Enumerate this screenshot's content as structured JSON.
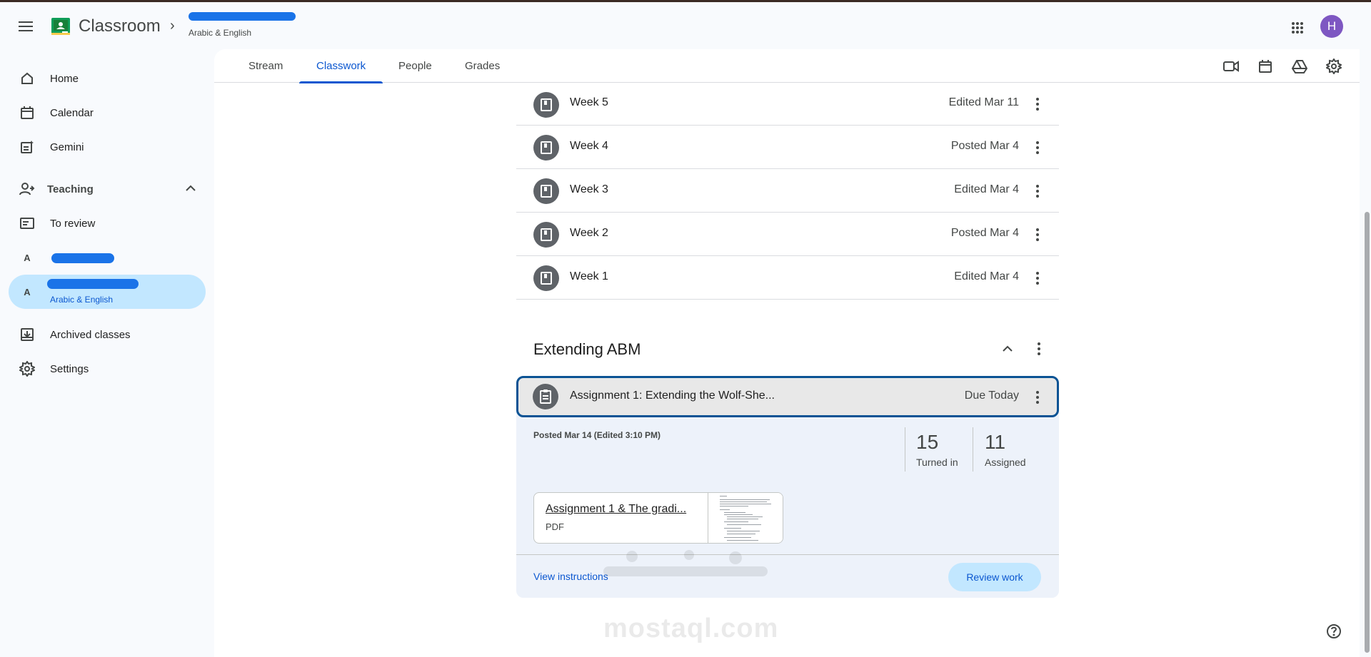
{
  "header": {
    "app_title": "Classroom",
    "class_subtitle": "Arabic & English",
    "avatar_letter": "H"
  },
  "sidebar": {
    "items": [
      {
        "label": "Home",
        "icon": "home-icon"
      },
      {
        "label": "Calendar",
        "icon": "calendar-icon"
      },
      {
        "label": "Gemini",
        "icon": "gemini-icon"
      }
    ],
    "teaching_label": "Teaching",
    "to_review_label": "To review",
    "classes": [
      {
        "letter": "A",
        "subtitle": ""
      },
      {
        "letter": "A",
        "subtitle": "Arabic & English"
      }
    ],
    "archived_label": "Archived classes",
    "settings_label": "Settings"
  },
  "tabs": [
    "Stream",
    "Classwork",
    "People",
    "Grades"
  ],
  "active_tab": "Classwork",
  "weeks": [
    {
      "title": "Week 5",
      "meta": "Edited Mar 11"
    },
    {
      "title": "Week 4",
      "meta": "Posted Mar 4"
    },
    {
      "title": "Week 3",
      "meta": "Edited Mar 4"
    },
    {
      "title": "Week 2",
      "meta": "Posted Mar 4"
    },
    {
      "title": "Week 1",
      "meta": "Edited Mar 4"
    }
  ],
  "section": {
    "title": "Extending ABM",
    "assignment": {
      "title": "Assignment 1: Extending the Wolf-She...",
      "due": "Due Today",
      "posted": "Posted Mar 14 (Edited 3:10 PM)",
      "turned_in_count": "15",
      "turned_in_label": "Turned in",
      "assigned_count": "11",
      "assigned_label": "Assigned",
      "attachment_title": "Assignment 1 & The gradi...",
      "attachment_type": "PDF",
      "view_instructions": "View instructions",
      "review_work": "Review work"
    }
  },
  "watermark": "mostaql.com",
  "colors": {
    "accent": "#0b57d0",
    "selected": "#c2e7ff",
    "avatar": "#7e57c2"
  }
}
